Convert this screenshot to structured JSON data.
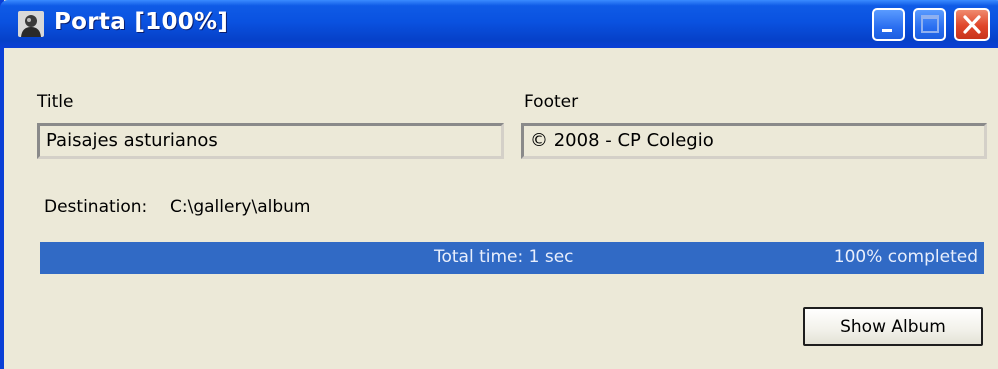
{
  "window": {
    "title": "Porta  [100%]",
    "controls": [
      "minimize",
      "maximize",
      "close"
    ]
  },
  "form": {
    "title_label": "Title",
    "title_value": "Paisajes asturianos",
    "footer_label": "Footer",
    "footer_value": "© 2008 - CP Colegio",
    "destination_label": "Destination:",
    "destination_value": "C:\\gallery\\album"
  },
  "progress": {
    "total_time_text": "Total time: 1 sec",
    "percent_text": "100% completed",
    "percent": 100,
    "fill_color": "#316ac5"
  },
  "actions": {
    "show_album_label": "Show Album"
  },
  "colors": {
    "window_bg": "#ece9d8",
    "titlebar": "#0a52e0",
    "close_button": "#e0462a"
  },
  "icons": {
    "app": "bust-portrait-icon",
    "minimize": "minimize-icon",
    "maximize": "maximize-icon",
    "close": "close-icon"
  }
}
